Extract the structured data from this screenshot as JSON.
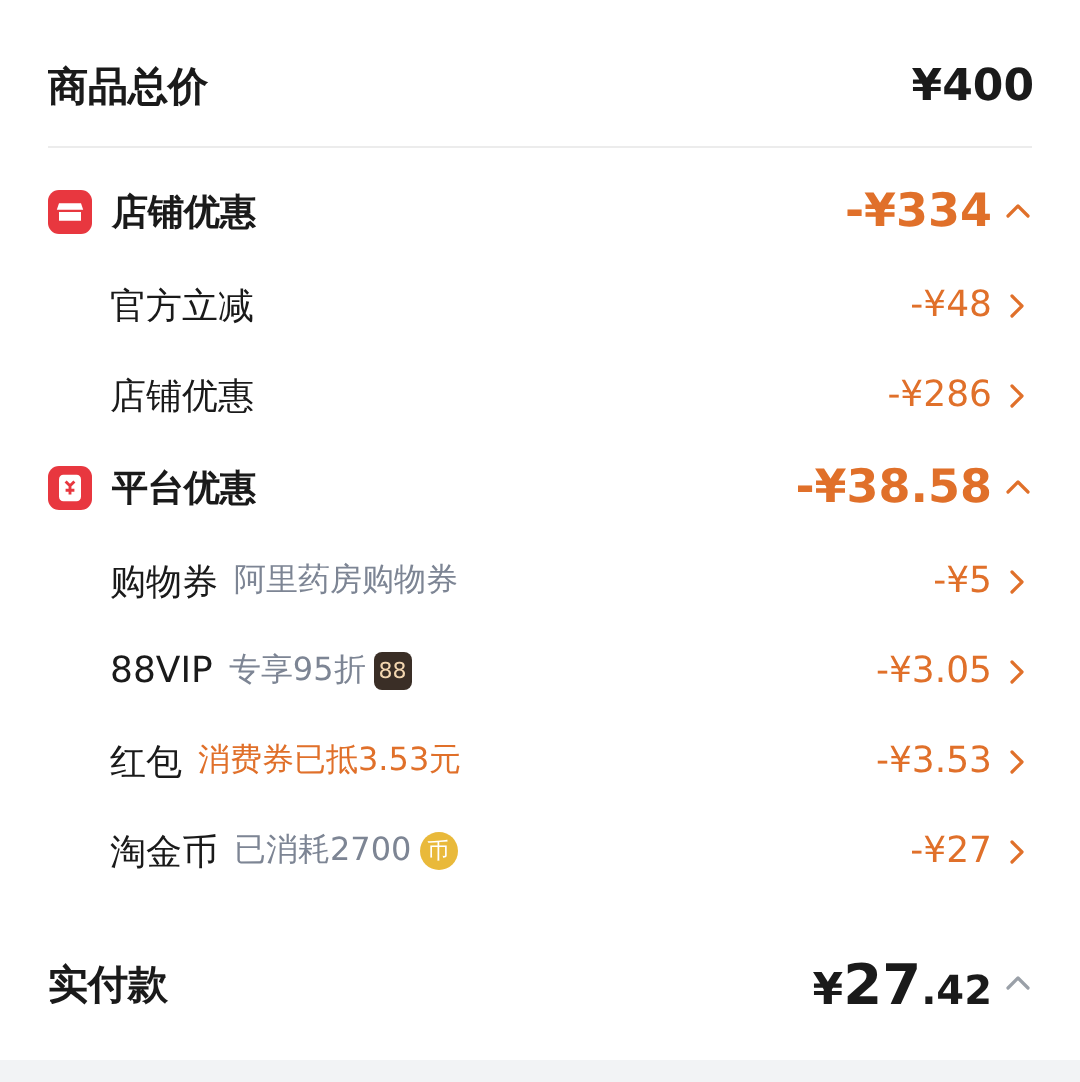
{
  "total": {
    "label": "商品总价",
    "amount": "¥400"
  },
  "groups": [
    {
      "title": "店铺优惠",
      "kind": "shop",
      "amount": "-¥334",
      "expanded": true,
      "items": [
        {
          "label": "官方立减",
          "amount": "-¥48"
        },
        {
          "label": "店铺优惠",
          "amount": "-¥286"
        }
      ]
    },
    {
      "title": "平台优惠",
      "kind": "coupon",
      "amount": "-¥38.58",
      "expanded": true,
      "items": [
        {
          "label": "购物券",
          "note": {
            "text": "阿里药房购物券",
            "color": "#7d8594"
          },
          "amount": "-¥5"
        },
        {
          "label": "88VIP",
          "note": {
            "text": "专享95折",
            "color": "#7d8594"
          },
          "badge": {
            "kind": "vip",
            "text": "88"
          },
          "amount": "-¥3.05"
        },
        {
          "label": "红包",
          "note": {
            "text": "消费券已抵3.53元",
            "color": "#e0702a"
          },
          "amount": "-¥3.53"
        },
        {
          "label": "淘金币",
          "note": {
            "text": "已消耗2700",
            "color": "#7d8594"
          },
          "badge": {
            "kind": "coin",
            "text": "币"
          },
          "amount": "-¥27"
        }
      ]
    }
  ],
  "paid": {
    "label": "实付款",
    "currency": "¥",
    "whole": "27",
    "fraction": ".42",
    "expanded": true
  }
}
